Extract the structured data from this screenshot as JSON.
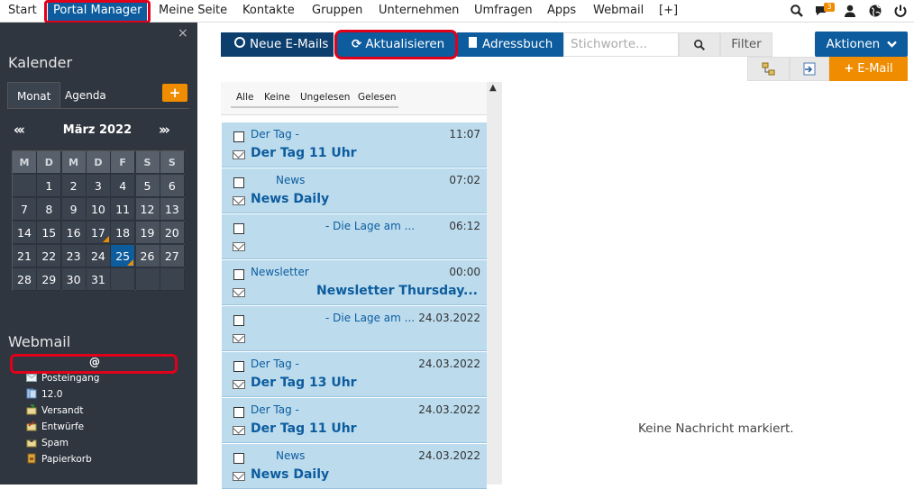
{
  "topnav": {
    "items": [
      "Start",
      "Portal Manager",
      "Meine Seite",
      "Kontakte",
      "Gruppen",
      "Unternehmen",
      "Umfragen",
      "Apps",
      "Webmail",
      "[+]"
    ],
    "active": "Portal Manager",
    "notification_count": "3",
    "icons": [
      "search-icon",
      "chat-icon",
      "user-icon",
      "globe-icon",
      "power-icon"
    ]
  },
  "sidebar": {
    "close_glyph": "×",
    "calendar_title": "Kalender",
    "tab_month": "Monat",
    "tab_agenda": "Agenda",
    "add_glyph": "+",
    "prev_glyph": "«‹",
    "next_glyph": "›»",
    "month_label": "März 2022",
    "weekdays": [
      "M",
      "D",
      "M",
      "D",
      "F",
      "S",
      "S"
    ],
    "weeks": [
      [
        "",
        "1",
        "2",
        "3",
        "4",
        "5",
        "6"
      ],
      [
        "7",
        "8",
        "9",
        "10",
        "11",
        "12",
        "13"
      ],
      [
        "14",
        "15",
        "16",
        "17",
        "18",
        "19",
        "20"
      ],
      [
        "21",
        "22",
        "23",
        "24",
        "25",
        "26",
        "27"
      ],
      [
        "28",
        "29",
        "30",
        "31",
        "",
        "",
        ""
      ]
    ],
    "today": "25",
    "marked_days": [
      "17",
      "25"
    ],
    "webmail_title": "Webmail",
    "account": "@",
    "folders": [
      "Posteingang",
      "12.0",
      "Versandt",
      "Entwürfe",
      "Spam",
      "Papierkorb"
    ]
  },
  "toolbar": {
    "new_emails": "Neue E-Mails",
    "refresh": "Aktualisieren",
    "addressbook": "Adressbuch",
    "search_placeholder": "Stichworte...",
    "filter": "Filter",
    "actions": "Aktionen",
    "email": "E-Mail"
  },
  "list": {
    "filters": [
      "Alle",
      "Keine",
      "Ungelesen",
      "Gelesen"
    ],
    "messages": [
      {
        "sender": "Der Tag -",
        "time": "11:07",
        "subject": "Der Tag 11 Uhr"
      },
      {
        "sender": "News",
        "time": "07:02",
        "subject": "News Daily"
      },
      {
        "sender": "- Die Lage am ...",
        "time": "06:12",
        "subject": ""
      },
      {
        "sender": "Newsletter",
        "time": "00:00",
        "subject": "Newsletter Thursday..."
      },
      {
        "sender": "- Die Lage am ...",
        "time": "24.03.2022",
        "subject": ""
      },
      {
        "sender": "Der Tag -",
        "time": "24.03.2022",
        "subject": "Der Tag 13 Uhr"
      },
      {
        "sender": "Der Tag -",
        "time": "24.03.2022",
        "subject": "Der Tag 11 Uhr"
      },
      {
        "sender": "News",
        "time": "24.03.2022",
        "subject": "News Daily"
      }
    ]
  },
  "preview": {
    "empty_text": "Keine Nachricht markiert."
  },
  "colors": {
    "primary": "#0d5c9e",
    "accent": "#f08c00",
    "sidebar_bg": "#2f3640",
    "message_bg": "#bcdcee",
    "highlight_ring": "#e0001a"
  }
}
